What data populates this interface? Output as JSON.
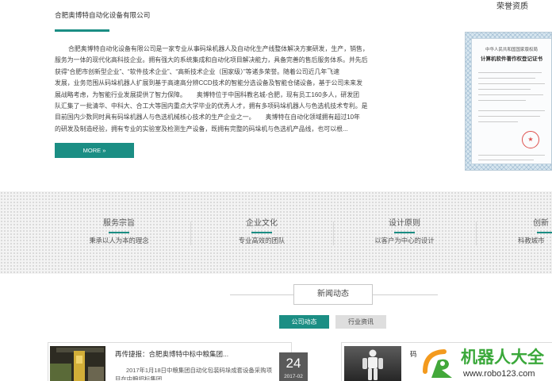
{
  "about": {
    "company_title": "合肥奥博特自动化设备有限公司",
    "intro_lines": [
      "合肥奥博特自动化设备有限公司是一家专业从事码垛机器人及自动化生产线整体解决方案研发，生产，销售，",
      "服务为一体的现代化高科技企业。拥有强大的系统集成和自动化项目解决能力，具备完善的售后服务体系。并先后",
      "获得“合肥市创新型企业”、“软件技术企业”、“高新技术企业（国家级）”等诸多荣誉。随着公司近几年飞速",
      "发展，业务范围从码垛机器人扩展到基于高速高分辨CCD技术的智能分选设备及智能仓储设备，基于公司未来发",
      "展战略考虑，为智能行业发展提供了智力保障。      奥博特位于中国科教名城-合肥，现有员工160多人，研发团",
      "队汇集了一批清华、中科大、合工大等国内重点大学毕业的优秀人才，拥有多项码垛机器人与色选机技术专利。是",
      "目前国内少数同时具有码垛机器人与色选机械核心技术的生产企业之一。      奥博特在自动化领域拥有超过10年",
      "的研发及制造经验，拥有专业的实验室及检测生产设备，既拥有完整的码垛机与色选机产品线，也可以根..."
    ],
    "more_label": "MORE »"
  },
  "honors": {
    "title": "荣誉资质",
    "certificate_issuer": "中华人民共和国国家版权局",
    "certificate_name": "计算机软件著作权登记证书"
  },
  "values": [
    {
      "title": "服务宗旨",
      "subtitle": "秉承以人为本的理念"
    },
    {
      "title": "企业文化",
      "subtitle": "专业高效的团队"
    },
    {
      "title": "设计原则",
      "subtitle": "以客户为中心的设计"
    },
    {
      "title": "创新",
      "subtitle": "科教城市"
    }
  ],
  "news": {
    "section_title": "新闻动态",
    "tabs": [
      {
        "label": "公司动态",
        "active": true
      },
      {
        "label": "行业资讯",
        "active": false
      }
    ],
    "items": [
      {
        "title": "再传捷报：合肥奥博特中标中粮集团...",
        "summary_lines": [
          "2017年1月18日中粮集团自动化包装码垛成套设备采购项",
          "目在中粮招标集团"
        ],
        "day": "24",
        "month": "2017-02"
      },
      {
        "title": "码"
      }
    ]
  },
  "watermark": {
    "brand": "机器人大全",
    "url": "www.robo123.com"
  },
  "colors": {
    "accent": "#1b8e84",
    "date_box": "#5a5a5a",
    "tab_inactive": "#dedede",
    "watermark_green": "#3aa83a",
    "watermark_orange": "#f39a1e",
    "seal": "#d9332f"
  }
}
